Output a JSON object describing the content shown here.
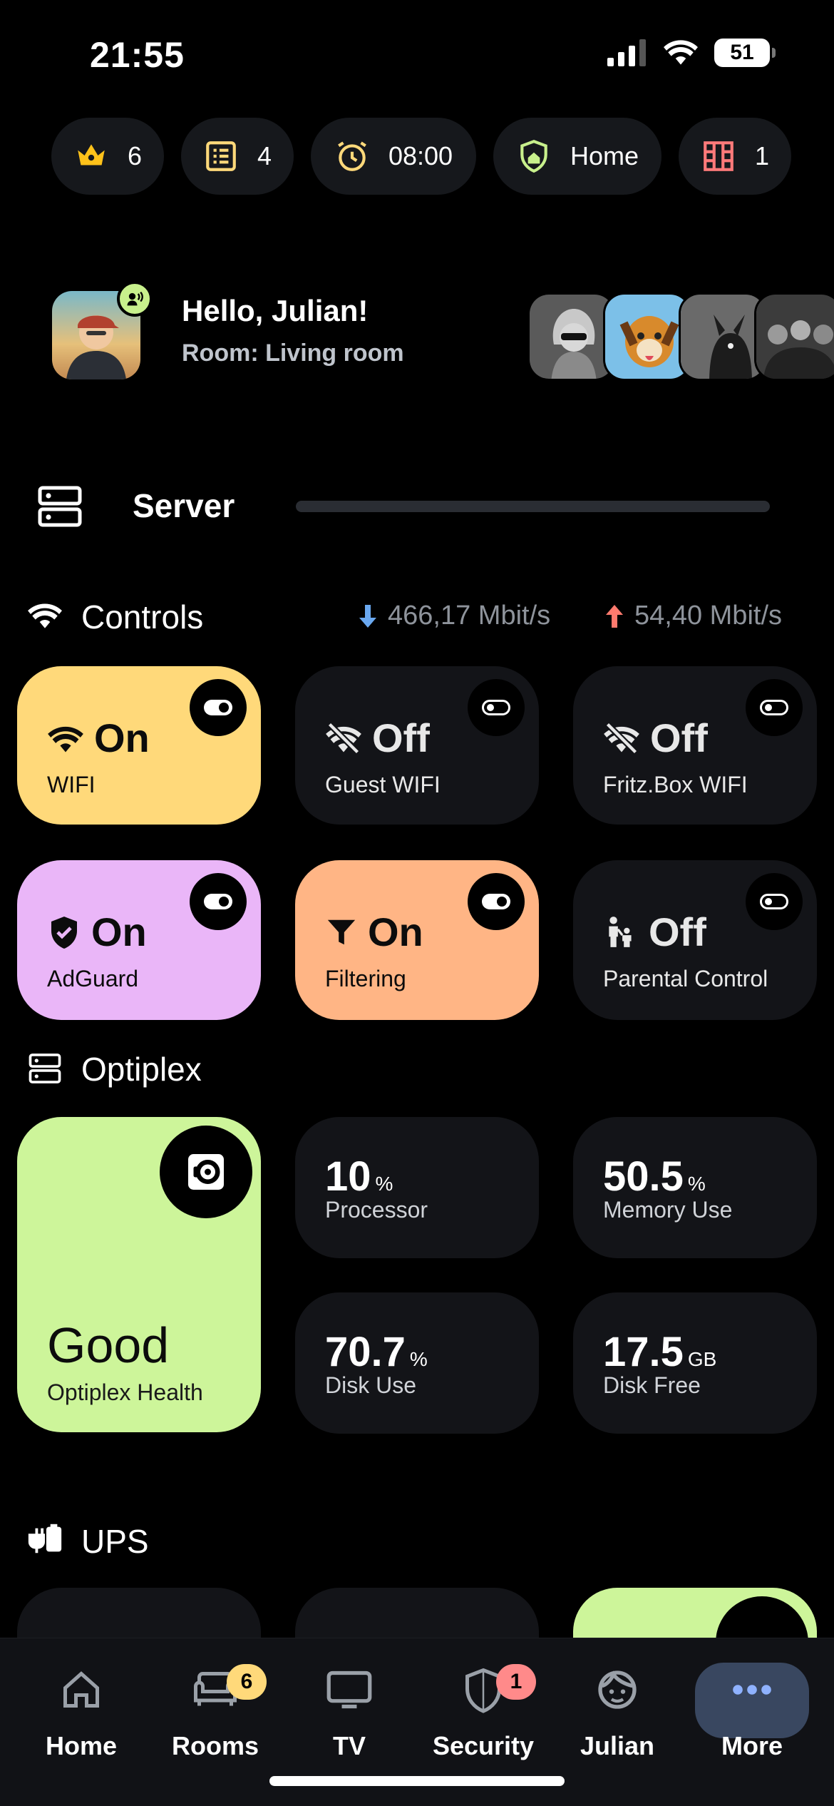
{
  "status_bar": {
    "time": "21:55",
    "battery": "51"
  },
  "chips": [
    {
      "icon": "crown-icon",
      "value": "6"
    },
    {
      "icon": "list-icon",
      "value": "4"
    },
    {
      "icon": "alarm-icon",
      "value": "08:00"
    },
    {
      "icon": "home-shield-icon",
      "value": "Home"
    },
    {
      "icon": "door-icon",
      "value": "1"
    }
  ],
  "greeting": {
    "hello": "Hello, Julian!",
    "room": "Room: Living room"
  },
  "server": {
    "label": "Server"
  },
  "controls": {
    "title": "Controls",
    "download": "466,17 Mbit/s",
    "upload": "54,40 Mbit/s",
    "tiles": [
      {
        "state": "On",
        "label": "WIFI",
        "icon": "wifi-icon",
        "color": "#ffd97a"
      },
      {
        "state": "Off",
        "label": "Guest WIFI",
        "icon": "wifi-off-icon"
      },
      {
        "state": "Off",
        "label": "Fritz.Box WIFI",
        "icon": "wifi-off-icon"
      },
      {
        "state": "On",
        "label": "AdGuard",
        "icon": "shield-check-icon",
        "color": "#eab6f8"
      },
      {
        "state": "On",
        "label": "Filtering",
        "icon": "filter-icon",
        "color": "#ffb585"
      },
      {
        "state": "Off",
        "label": "Parental Control",
        "icon": "parent-child-icon"
      }
    ]
  },
  "optiplex": {
    "title": "Optiplex",
    "health": {
      "value": "Good",
      "label": "Optiplex Health",
      "color": "#cdf59a"
    },
    "metrics": [
      {
        "value": "10",
        "unit": "%",
        "label": "Processor"
      },
      {
        "value": "50.5",
        "unit": "%",
        "label": "Memory Use"
      },
      {
        "value": "70.7",
        "unit": "%",
        "label": "Disk Use"
      },
      {
        "value": "17.5",
        "unit": "GB",
        "label": "Disk Free"
      }
    ]
  },
  "ups": {
    "title": "UPS"
  },
  "nav": [
    {
      "label": "Home",
      "icon": "home-icon"
    },
    {
      "label": "Rooms",
      "icon": "sofa-icon",
      "badge": "6",
      "badge_color": "#ffd97a"
    },
    {
      "label": "TV",
      "icon": "tv-icon"
    },
    {
      "label": "Security",
      "icon": "shield-icon",
      "badge": "1",
      "badge_color": "#ff8a8a"
    },
    {
      "label": "Julian",
      "icon": "user-face-icon"
    },
    {
      "label": "More",
      "icon": "more-dots-icon"
    }
  ]
}
